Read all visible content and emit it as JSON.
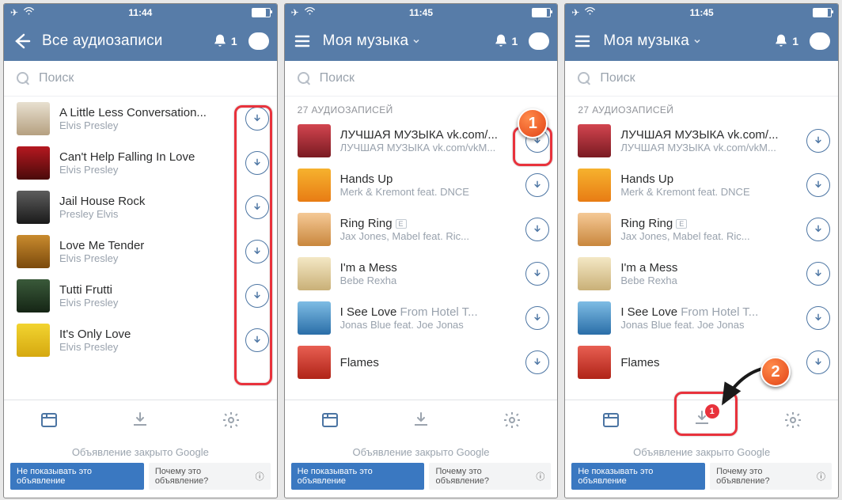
{
  "status_time": {
    "s1": "11:44",
    "s2": "11:45",
    "s3": "11:45"
  },
  "nav": {
    "title1": "Все аудиозаписи",
    "title2": "Моя музыка",
    "title3": "Моя музыка",
    "badge": "1"
  },
  "search": {
    "placeholder": "Поиск"
  },
  "section": {
    "label": "27 АУДИОЗАПИСЕЙ"
  },
  "ad": {
    "closed": "Объявление закрыто Google",
    "btn1": "Не показывать это объявление",
    "btn2": "Почему это объявление?"
  },
  "download_badge": "1",
  "screen1": {
    "tracks": [
      {
        "title": "A Little Less Conversation...",
        "artist": "Elvis Presley",
        "art": "a-elvis1"
      },
      {
        "title": "Can't Help Falling In Love",
        "artist": "Elvis Presley",
        "art": "a-elvis2"
      },
      {
        "title": "Jail House Rock",
        "artist": "Presley Elvis",
        "art": "a-elvis3"
      },
      {
        "title": "Love Me Tender",
        "artist": "Elvis Presley",
        "art": "a-elvis4"
      },
      {
        "title": "Tutti Frutti",
        "artist": "Elvis Presley",
        "art": "a-elvis5"
      },
      {
        "title": "It's Only Love",
        "artist": "Elvis Presley",
        "art": "a-elvis6"
      }
    ]
  },
  "screen2": {
    "tracks": [
      {
        "title": "ЛУЧШАЯ МУЗЫКА vk.com/...",
        "artist": "ЛУЧШАЯ МУЗЫКА vk.com/vkM...",
        "art": "a-m1",
        "e": false
      },
      {
        "title": "Hands Up",
        "artist": "Merk & Kremont feat. DNCE",
        "art": "a-m2",
        "e": false
      },
      {
        "title": "Ring Ring",
        "artist": "Jax Jones, Mabel feat. Ric...",
        "art": "a-m3",
        "e": true
      },
      {
        "title": "I'm a Mess",
        "artist": "Bebe Rexha",
        "art": "a-m4",
        "e": false
      },
      {
        "title": "I See Love",
        "title_grey": "From Hotel T...",
        "artist": "Jonas Blue feat. Joe Jonas",
        "art": "a-m5",
        "e": false
      },
      {
        "title": "Flames",
        "artist": "",
        "art": "a-m6",
        "e": false
      }
    ]
  }
}
